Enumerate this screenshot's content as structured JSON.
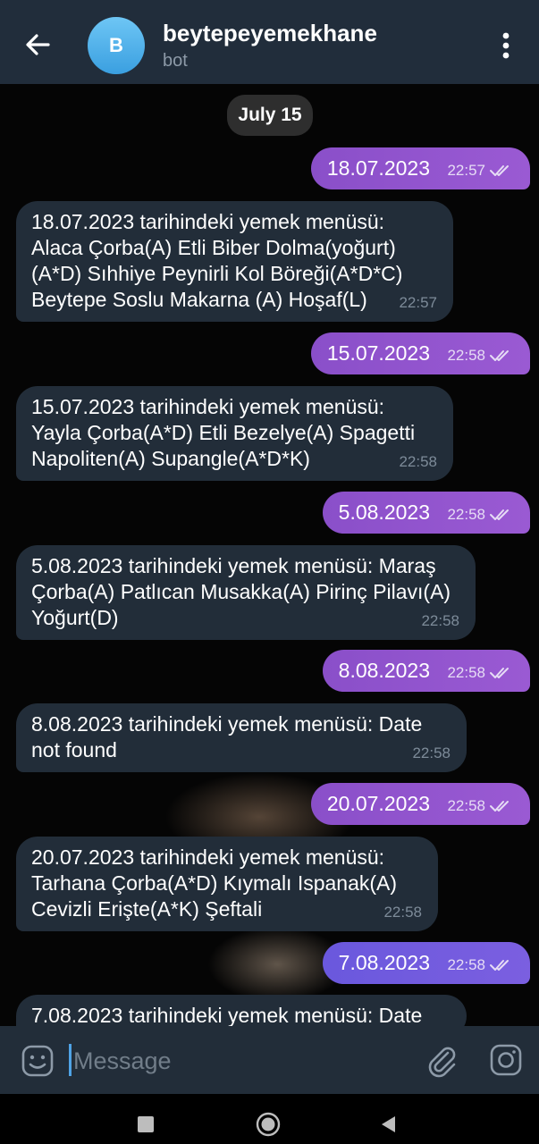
{
  "header": {
    "avatar_letter": "B",
    "title": "beytepeyemekhane",
    "subtitle": "bot"
  },
  "date_separator": "July 15",
  "messages": [
    {
      "dir": "out",
      "text": "18.07.2023",
      "time": "22:57"
    },
    {
      "dir": "in",
      "text": "18.07.2023 tarihindeki yemek menüsü: Alaca Çorba(A) Etli Biber Dolma(yoğurt)(A*D) Sıhhiye Peynirli Kol Böreği(A*D*C) Beytepe Soslu Makarna (A) Hoşaf(L)",
      "time": "22:57"
    },
    {
      "dir": "out",
      "text": "15.07.2023",
      "time": "22:58"
    },
    {
      "dir": "in",
      "text": "15.07.2023 tarihindeki yemek menüsü: Yayla Çorba(A*D) Etli Bezelye(A) Spagetti Napoliten(A) Supangle(A*D*K)",
      "time": "22:58"
    },
    {
      "dir": "out",
      "text": "5.08.2023",
      "time": "22:58"
    },
    {
      "dir": "in",
      "text": "5.08.2023 tarihindeki yemek menüsü: Maraş Çorba(A) Patlıcan Musakka(A) Pirinç Pilavı(A) Yoğurt(D)",
      "time": "22:58"
    },
    {
      "dir": "out",
      "text": "8.08.2023",
      "time": "22:58"
    },
    {
      "dir": "in",
      "text": "8.08.2023 tarihindeki yemek menüsü: Date not found",
      "time": "22:58"
    },
    {
      "dir": "out",
      "text": "20.07.2023",
      "time": "22:58"
    },
    {
      "dir": "in",
      "text": "20.07.2023 tarihindeki yemek menüsü: Tarhana Çorba(A*D) Kıymalı Ispanak(A) Cevizli Erişte(A*K) Şeftali",
      "time": "22:58"
    },
    {
      "dir": "out",
      "text": "7.08.2023",
      "time": "22:58"
    },
    {
      "dir": "in",
      "text": "7.08.2023 tarihindeki yemek menüsü: Date",
      "time": ""
    }
  ],
  "input": {
    "placeholder": "Message",
    "value": ""
  },
  "icons": {
    "back": "arrow-left-icon",
    "menu": "more-vertical-icon",
    "read": "double-check-icon",
    "emoji": "emoji-icon",
    "attach": "paperclip-icon",
    "camera": "instagram-camera-icon"
  },
  "colors": {
    "header_bg": "#212d3b",
    "outgoing_bubble": "#9a5ad3",
    "incoming_bubble": "#222d39",
    "accent": "#4fa3e6"
  }
}
